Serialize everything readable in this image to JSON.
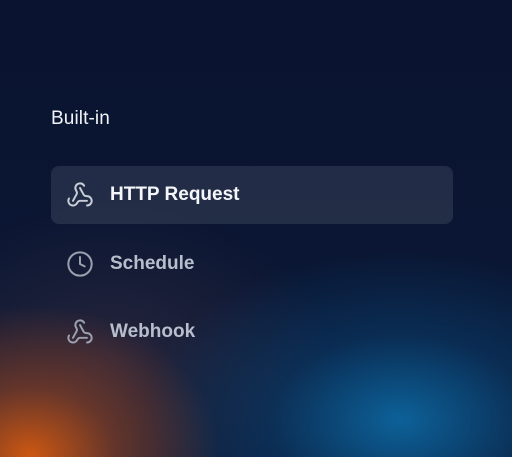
{
  "section": {
    "title": "Built-in"
  },
  "items": [
    {
      "label": "HTTP Request",
      "icon": "webhook-icon",
      "selected": true
    },
    {
      "label": "Schedule",
      "icon": "clock-icon",
      "selected": false
    },
    {
      "label": "Webhook",
      "icon": "webhook-icon",
      "selected": false
    }
  ],
  "colors": {
    "selected_bg": "#262d3a",
    "text_primary": "#f4f6fa",
    "text_secondary": "#b8bfcc",
    "accent_orange": "#d65a10",
    "accent_blue": "#0c6eaa"
  }
}
